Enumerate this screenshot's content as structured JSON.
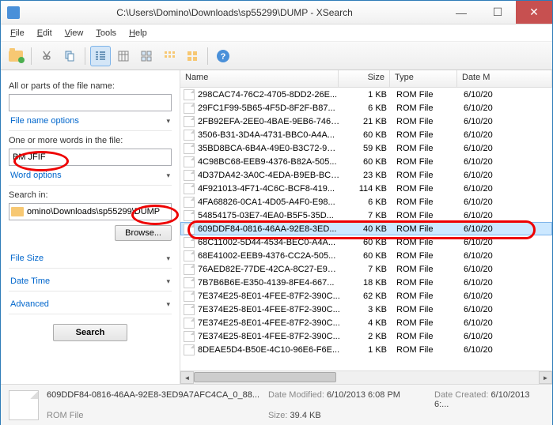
{
  "window": {
    "title": "C:\\Users\\Domino\\Downloads\\sp55299\\DUMP - XSearch"
  },
  "menu": {
    "file": "File",
    "edit": "Edit",
    "view": "View",
    "tools": "Tools",
    "help": "Help"
  },
  "sidebar": {
    "name_label": "All or parts of the file name:",
    "name_value": "",
    "file_name_options": "File name options",
    "words_label": "One or more words in the file:",
    "words_value": "BM JFIF",
    "word_options": "Word options",
    "search_in": "Search in:",
    "path": "omino\\Downloads\\sp55299\\DUMP",
    "browse": "Browse...",
    "file_size": "File Size",
    "date_time": "Date Time",
    "advanced": "Advanced",
    "search": "Search"
  },
  "headers": {
    "name": "Name",
    "size": "Size",
    "type": "Type",
    "date": "Date M"
  },
  "rows": [
    {
      "name": "298CAC74-76C2-4705-8DD2-26E...",
      "size": "1 KB",
      "type": "ROM File",
      "date": "6/10/20"
    },
    {
      "name": "29FC1F99-5B65-4F5D-8F2F-B87...",
      "size": "6 KB",
      "type": "ROM File",
      "date": "6/10/20"
    },
    {
      "name": "2FB92EFA-2EE0-4BAE-9EB6-7464...",
      "size": "21 KB",
      "type": "ROM File",
      "date": "6/10/20"
    },
    {
      "name": "3506-B31-3D4A-4731-BBC0-A4A...",
      "size": "60 KB",
      "type": "ROM File",
      "date": "6/10/20"
    },
    {
      "name": "35BD8BCA-6B4A-49E0-B3C72-904...",
      "size": "59 KB",
      "type": "ROM File",
      "date": "6/10/20"
    },
    {
      "name": "4C98BC68-EEB9-4376-B82A-505...",
      "size": "60 KB",
      "type": "ROM File",
      "date": "6/10/20"
    },
    {
      "name": "4D37DA42-3A0C-4EDA-B9EB-BC0...",
      "size": "23 KB",
      "type": "ROM File",
      "date": "6/10/20"
    },
    {
      "name": "4F921013-4F71-4C6C-BCF8-419...",
      "size": "114 KB",
      "type": "ROM File",
      "date": "6/10/20"
    },
    {
      "name": "4FA68826-0CA1-4D05-A4F0-E98...",
      "size": "6 KB",
      "type": "ROM File",
      "date": "6/10/20"
    },
    {
      "name": "54854175-03E7-4EA0-B5F5-35D...",
      "size": "7 KB",
      "type": "ROM File",
      "date": "6/10/20"
    },
    {
      "name": "609DDF84-0816-46AA-92E8-3ED...",
      "size": "40 KB",
      "type": "ROM File",
      "date": "6/10/20",
      "selected": true
    },
    {
      "name": "68C11002-5D44-4534-BEC0-A4A...",
      "size": "60 KB",
      "type": "ROM File",
      "date": "6/10/20"
    },
    {
      "name": "68E41002-EEB9-4376-CC2A-505...",
      "size": "60 KB",
      "type": "ROM File",
      "date": "6/10/20"
    },
    {
      "name": "76AED82E-77DE-42CA-8C27-E9D...",
      "size": "7 KB",
      "type": "ROM File",
      "date": "6/10/20"
    },
    {
      "name": "7B7B6B6E-E350-4139-8FE4-667...",
      "size": "18 KB",
      "type": "ROM File",
      "date": "6/10/20"
    },
    {
      "name": "7E374E25-8E01-4FEE-87F2-390C...",
      "size": "62 KB",
      "type": "ROM File",
      "date": "6/10/20"
    },
    {
      "name": "7E374E25-8E01-4FEE-87F2-390C...",
      "size": "3 KB",
      "type": "ROM File",
      "date": "6/10/20"
    },
    {
      "name": "7E374E25-8E01-4FEE-87F2-390C...",
      "size": "4 KB",
      "type": "ROM File",
      "date": "6/10/20"
    },
    {
      "name": "7E374E25-8E01-4FEE-87F2-390C...",
      "size": "2 KB",
      "type": "ROM File",
      "date": "6/10/20"
    },
    {
      "name": "8DEAE5D4-B50E-4C10-96E6-F6E...",
      "size": "1 KB",
      "type": "ROM File",
      "date": "6/10/20"
    }
  ],
  "status": {
    "filename": "609DDF84-0816-46AA-92E8-3ED9A7AFC4CA_0_88...",
    "type": "ROM File",
    "modified_label": "Date Modified:",
    "modified": "6/10/2013 6:08 PM",
    "created_label": "Date Created:",
    "created": "6/10/2013 6:...",
    "size_label": "Size:",
    "size": "39.4 KB"
  }
}
